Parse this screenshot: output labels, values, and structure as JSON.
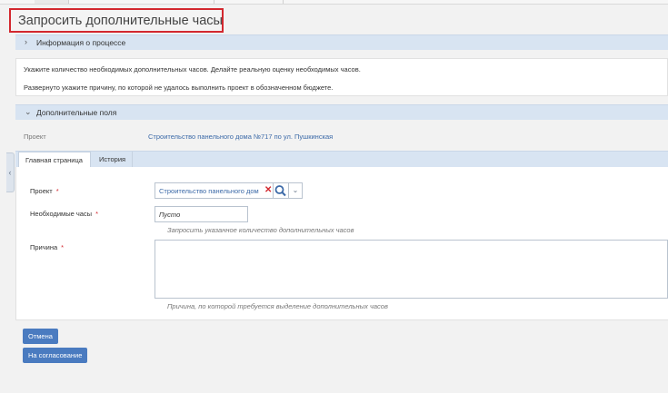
{
  "page_title": "Запросить дополнительные часы",
  "process_info": {
    "arrow": "›",
    "label": "Информация о процессе"
  },
  "instructions": [
    "Укажите количество необходимых дополнительных часов. Делайте реальную оценку необходимых часов.",
    "Развернуто укажите  причину, по которой не удалось выполнить проект в обозначенном бюджете."
  ],
  "extra_fields": {
    "arrow": "⌄",
    "label": "Дополнительные поля",
    "project_label": "Проект",
    "project_value": "Строительство панельного дома №717 по ул. Пушкинская"
  },
  "tabs": [
    {
      "label": "Главная страница",
      "active": true
    },
    {
      "label": "История",
      "active": false
    }
  ],
  "form": {
    "project": {
      "label": "Проект",
      "required_mark": "*",
      "value": "Строительство панельного дом",
      "clear_glyph": "✕",
      "dropdown_glyph": "⌄"
    },
    "hours": {
      "label": "Необходимые часы",
      "required_mark": "*",
      "value": "Пусто",
      "hint": "Запросить указанное количество дополнительных часов"
    },
    "reason": {
      "label": "Причина",
      "required_mark": "*",
      "value": "",
      "hint": "Причина, по которой требуется выделение дополнительных часов"
    }
  },
  "buttons": {
    "cancel": "Отмена",
    "submit": "На согласование"
  },
  "left_handle_glyph": "‹",
  "colors": {
    "accent": "#4a7bc0",
    "panel_header": "#d8e4f2",
    "link": "#3c6aa8",
    "required": "#d3282f",
    "title_highlight": "#d3282f"
  }
}
